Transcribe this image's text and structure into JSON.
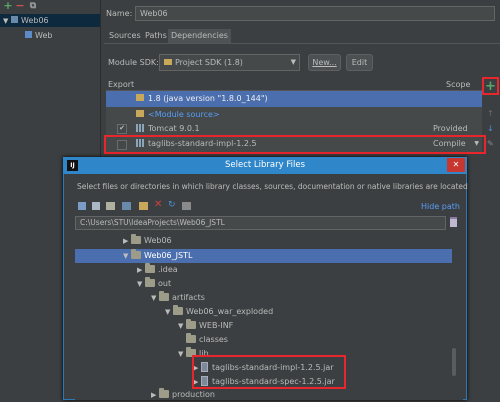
{
  "project_tree": {
    "toolbar": {
      "add": "+",
      "remove": "−",
      "copy": "⧉"
    },
    "items": [
      {
        "label": "Web06",
        "icon": "module-icon"
      },
      {
        "label": "Web",
        "icon": "web-facet-icon"
      }
    ]
  },
  "module_settings": {
    "name_label": "Name:",
    "name_value": "Web06",
    "tabs": [
      "Sources",
      "Paths",
      "Dependencies"
    ],
    "active_tab": "Dependencies",
    "sdk_label": "Module SDK:",
    "sdk_value": "Project SDK (1.8)",
    "new_button": "New...",
    "edit_button": "Edit",
    "table_headers": {
      "export": "Export",
      "scope": "Scope"
    },
    "dependencies": [
      {
        "label": "1.8 (java version \"1.8.0_144\")",
        "scope": "",
        "selected": true
      },
      {
        "label": "<Module source>",
        "scope": ""
      },
      {
        "label": "Tomcat 9.0.1",
        "scope": "Provided",
        "checked": true
      },
      {
        "label": "taglibs-standard-impl-1.2.5",
        "scope": "Compile"
      }
    ],
    "side_buttons": {
      "add": "+",
      "up": "↑",
      "down": "↓",
      "edit": "✎"
    }
  },
  "dialog": {
    "title_icon": "IJ",
    "title": "Select Library Files",
    "close": "✕",
    "description": "Select files or directories in which library classes, sources, documentation or native libraries are located",
    "hide_path": "Hide path",
    "path_value": "C:\\Users\\STU\\IdeaProjects\\Web06_JSTL",
    "tree": [
      {
        "label": "Web06",
        "arrow": "▶"
      },
      {
        "label": "Web06_JSTL",
        "arrow": "▼",
        "selected": true
      },
      {
        "label": ".idea",
        "arrow": "▶"
      },
      {
        "label": "out",
        "arrow": "▼"
      },
      {
        "label": "artifacts",
        "arrow": "▼"
      },
      {
        "label": "Web06_war_exploded",
        "arrow": "▼"
      },
      {
        "label": "WEB-INF",
        "arrow": "▼"
      },
      {
        "label": "classes",
        "arrow": ""
      },
      {
        "label": "lib",
        "arrow": "▼"
      },
      {
        "label": "taglibs-standard-impl-1.2.5.jar",
        "arrow": "▶"
      },
      {
        "label": "taglibs-standard-spec-1.2.5.jar",
        "arrow": "▶"
      },
      {
        "label": "production",
        "arrow": "▶"
      }
    ]
  },
  "colors": {
    "accent": "#4b6eaf",
    "highlight": "#e8262b",
    "add_green": "#59a869"
  }
}
